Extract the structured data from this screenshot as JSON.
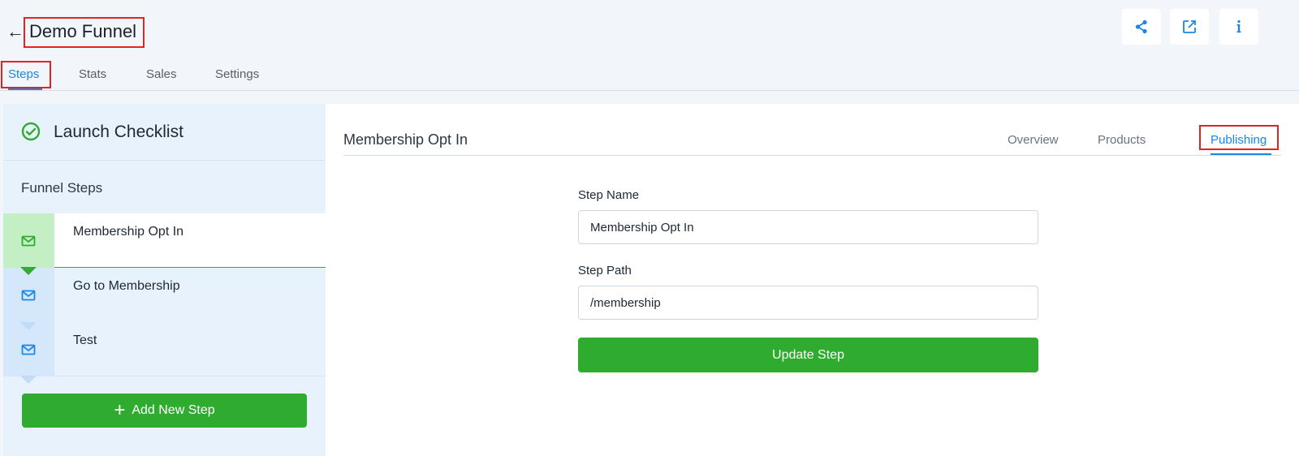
{
  "header": {
    "back_icon": "←",
    "title": "Demo Funnel",
    "icons": [
      "share-icon",
      "external-link-icon",
      "info-icon"
    ]
  },
  "tabs": [
    {
      "label": "Steps",
      "active": true
    },
    {
      "label": "Stats",
      "active": false
    },
    {
      "label": "Sales",
      "active": false
    },
    {
      "label": "Settings",
      "active": false
    }
  ],
  "sidebar": {
    "checklist_label": "Launch Checklist",
    "funnel_steps_label": "Funnel Steps",
    "steps": [
      {
        "label": "Membership Opt In",
        "active": true,
        "icon": "mail-icon"
      },
      {
        "label": "Go to Membership",
        "active": false,
        "icon": "mail-icon"
      },
      {
        "label": "Test",
        "active": false,
        "icon": "mail-icon"
      }
    ],
    "add_step_label": "Add New Step"
  },
  "main": {
    "step_title": "Membership Opt In",
    "tabs": [
      {
        "label": "Overview",
        "active": false
      },
      {
        "label": "Products",
        "active": false
      },
      {
        "label": "Publishing",
        "active": true
      }
    ],
    "form": {
      "step_name_label": "Step Name",
      "step_name_value": "Membership Opt In",
      "step_path_label": "Step Path",
      "step_path_value": "/membership",
      "update_label": "Update Step"
    }
  },
  "colors": {
    "accent_blue": "#1a86e8",
    "success_green": "#2fac2f",
    "highlight_red": "#e02424"
  }
}
